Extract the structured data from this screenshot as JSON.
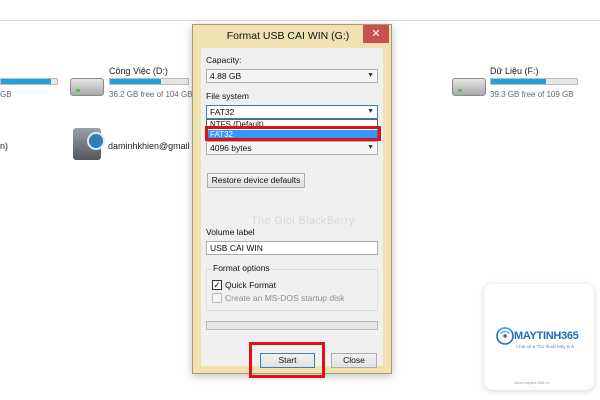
{
  "explorer": {
    "drives": [
      {
        "name": "",
        "free_text": "GB",
        "fill": 0.9
      },
      {
        "name": "Công Việc (D:)",
        "free_text": "36.2 GB free of 104 GB",
        "fill": 0.65
      },
      {
        "name": "Dữ Liệu (F:)",
        "free_text": "39.3 GB free of 109 GB",
        "fill": 0.64
      }
    ],
    "row2_left_text": "n)",
    "user_label": "daminhkhien@gmail"
  },
  "dialog": {
    "title": "Format USB CAI WIN (G:)",
    "close_glyph": "✕",
    "capacity_label": "Capacity:",
    "capacity_value": "4.88 GB",
    "filesystem_label": "File system",
    "filesystem_value": "FAT32",
    "filesystem_options": [
      "NTFS (Default)",
      "FAT32"
    ],
    "allocation_value": "4096 bytes",
    "restore_label": "Restore device defaults",
    "volume_label": "Volume label",
    "volume_value": "USB CAI WIN",
    "format_options_label": "Format options",
    "quick_format_label": "Quick Format",
    "msdos_label": "Create an MS-DOS startup disk",
    "start_label": "Start",
    "close_label": "Close",
    "watermark": "The Gioi BlackBerry",
    "arrow_glyph": "▼",
    "check_glyph": "✓"
  },
  "logo": {
    "name": "MAYTINH365",
    "tagline": "Chia sẻ & Thủ thuật Máy tính",
    "footer": "www.maytinh365.vn"
  },
  "colors": {
    "highlight_box": "#e01019",
    "selection": "#3399ff",
    "drive_bar": "#26a0da",
    "dialog_frame": "#f0e2b0",
    "close_button": "#c75050"
  }
}
